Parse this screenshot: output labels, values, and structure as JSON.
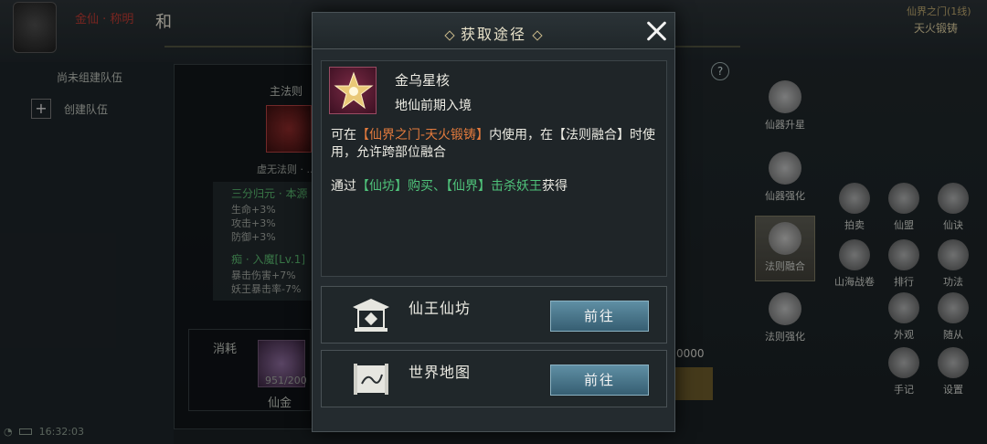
{
  "background": {
    "top_player_name": "金仙 · 称明",
    "top_left_tag": "和",
    "team_status": "尚未组建队伍",
    "create_team": "创建队伍",
    "main_law_label": "主法则",
    "law_caption": "虚无法则 · ...",
    "set_name": "三分归元 · 本源",
    "stats": [
      "生命+3%",
      "攻击+3%",
      "防御+3%"
    ],
    "buff_name": "痴 · 入魔[Lv.1]",
    "buff_stats": [
      "暴击伤害+7%",
      "妖王暴击率-7%"
    ],
    "consume_label": "消耗",
    "consume_item_count": "951/200",
    "consume_item_name": "仙金",
    "cost_value": "0000",
    "right_rail": [
      "仙器升星",
      "仙器强化",
      "法则融合",
      "法则强化"
    ],
    "right_grid": [
      "拍卖",
      "仙盟",
      "仙诀",
      "山海战卷",
      "排行",
      "功法",
      "外观",
      "随从",
      "手记",
      "设置"
    ],
    "top_right_server": "仙界之门(1线)",
    "top_right_sub": "天火锻铸",
    "help_mark": "?",
    "time": "16:32:03"
  },
  "modal": {
    "title": "获取途径",
    "item_name": "金乌星核",
    "item_requirement": "地仙前期入境",
    "desc_prefix": "可在",
    "desc_highlight": "【仙界之门-天火锻铸】",
    "desc_mid": "内使用，在【法则融合】时使用，允许跨部位融合",
    "source_prefix": "通过",
    "source_shop": "【仙坊】",
    "source_buy": "购买、",
    "source_world": "【仙界】",
    "source_kill": "击杀妖王",
    "source_suffix": "获得",
    "routes": [
      {
        "label": "仙王仙坊",
        "button": "前往"
      },
      {
        "label": "世界地图",
        "button": "前往"
      }
    ]
  },
  "colors": {
    "accent_orange": "#e27a3d",
    "accent_green": "#4fc27a",
    "button_blue": "#4a7a8f"
  }
}
